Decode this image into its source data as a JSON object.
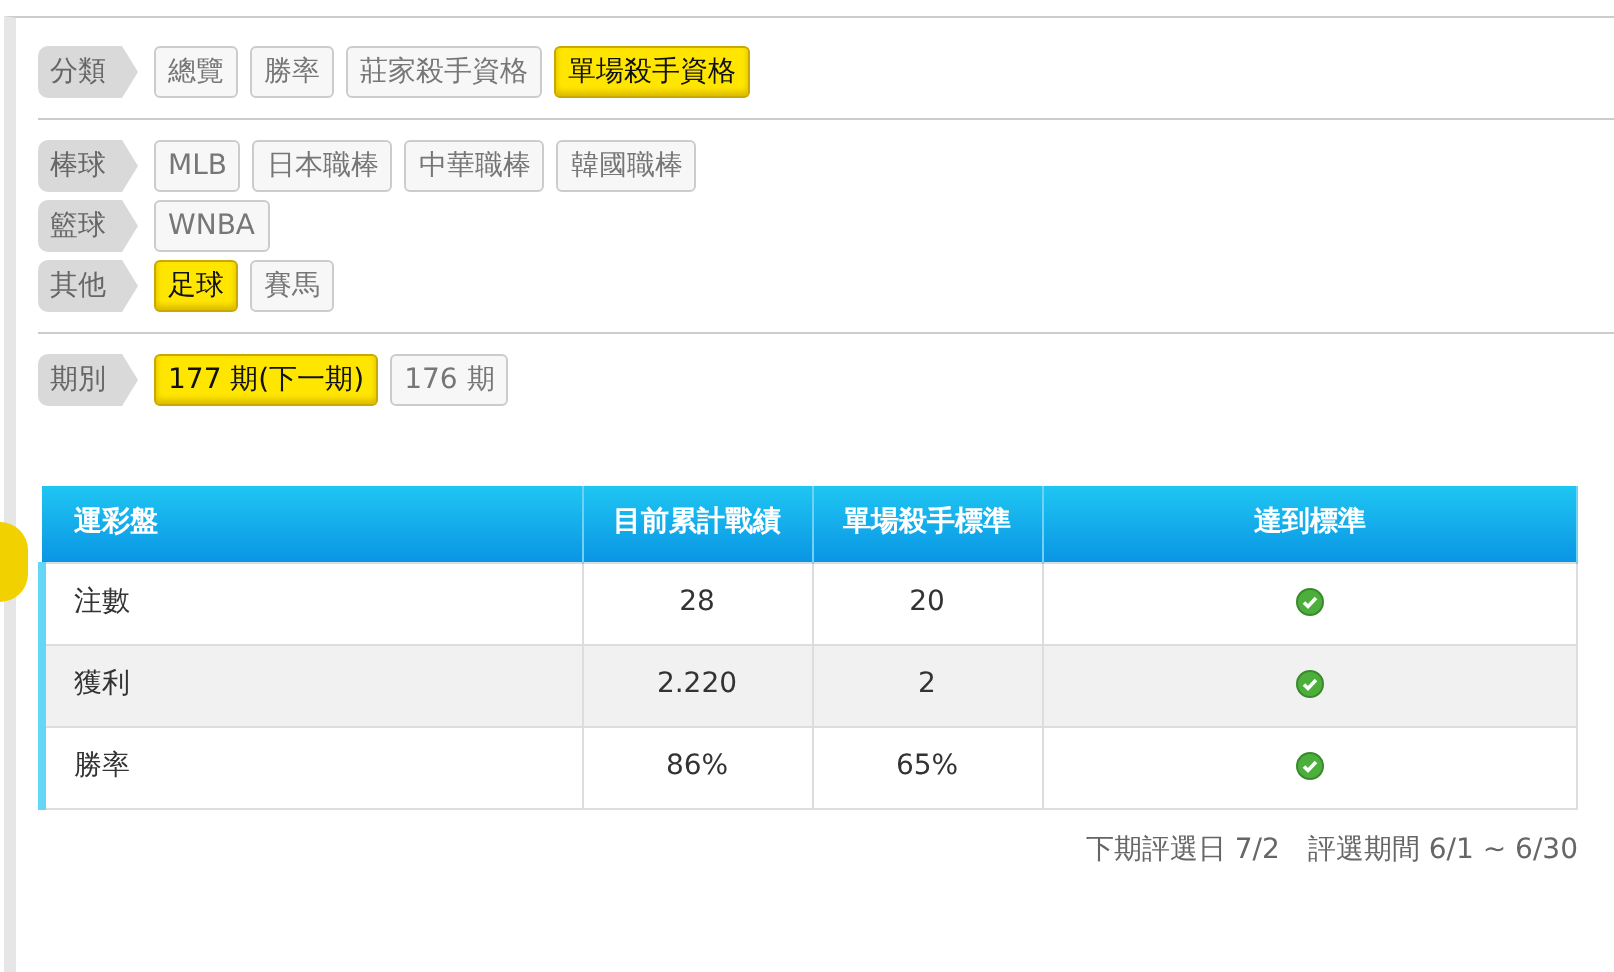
{
  "filters": [
    {
      "label": "分類",
      "options": [
        {
          "text": "總覽",
          "selected": false
        },
        {
          "text": "勝率",
          "selected": false
        },
        {
          "text": "莊家殺手資格",
          "selected": false
        },
        {
          "text": "單場殺手資格",
          "selected": true
        }
      ],
      "divider_after": true
    },
    {
      "label": "棒球",
      "options": [
        {
          "text": "MLB",
          "selected": false
        },
        {
          "text": "日本職棒",
          "selected": false
        },
        {
          "text": "中華職棒",
          "selected": false
        },
        {
          "text": "韓國職棒",
          "selected": false
        }
      ],
      "divider_after": false
    },
    {
      "label": "籃球",
      "options": [
        {
          "text": "WNBA",
          "selected": false
        }
      ],
      "divider_after": false
    },
    {
      "label": "其他",
      "options": [
        {
          "text": "足球",
          "selected": true
        },
        {
          "text": "賽馬",
          "selected": false
        }
      ],
      "divider_after": true
    },
    {
      "label": "期別",
      "options": [
        {
          "text": "177 期(下一期)",
          "selected": true
        },
        {
          "text": "176 期",
          "selected": false
        }
      ],
      "divider_after": false
    }
  ],
  "table": {
    "columns": [
      "運彩盤",
      "目前累計戰績",
      "單場殺手標準",
      "達到標準"
    ],
    "rows": [
      {
        "item": "注數",
        "current": "28",
        "standard": "20",
        "met": true
      },
      {
        "item": "獲利",
        "current": "2.220",
        "standard": "2",
        "met": true
      },
      {
        "item": "勝率",
        "current": "86%",
        "standard": "65%",
        "met": true
      }
    ]
  },
  "footer": {
    "next_date": "下期評選日 7/2",
    "period": "評選期間 6/1 ~ 6/30"
  }
}
